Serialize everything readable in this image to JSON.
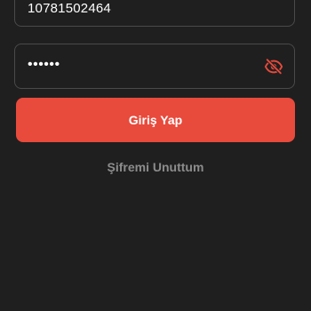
{
  "form": {
    "phone_value": "10781502464",
    "password_value": "••••••",
    "login_label": "Giriş Yap",
    "forgot_label": "Şifremi Unuttum"
  },
  "icons": {
    "password_toggle": "eye-off-icon"
  },
  "colors": {
    "background": "#1f1f1f",
    "accent": "#e84a3c",
    "field_border": "#4a4a4a",
    "muted_text": "#8c8c8c"
  }
}
